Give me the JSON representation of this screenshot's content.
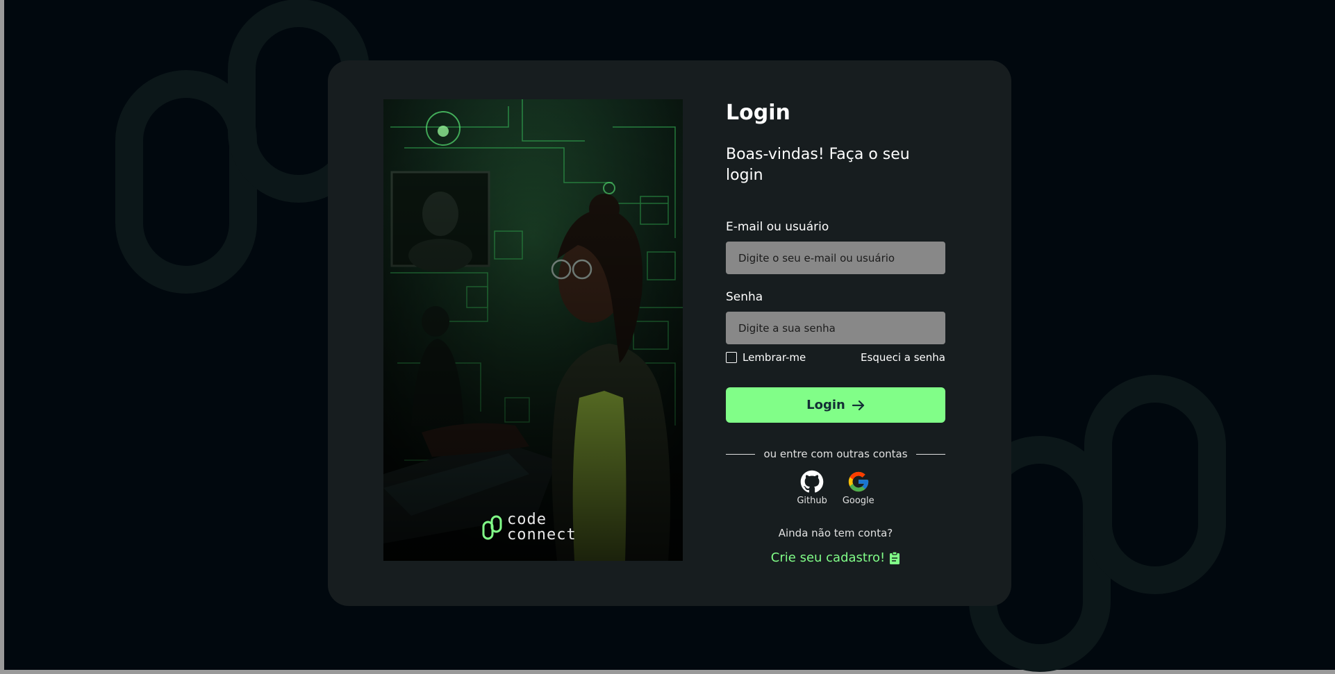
{
  "colors": {
    "background": "#01080e",
    "card": "#171d1f",
    "accent": "#81fe88",
    "input_bg": "#888888",
    "text": "#e1e1e1"
  },
  "banner": {
    "logo_line1": "code",
    "logo_line2": "connect",
    "logo_icon": "chain-link-icon"
  },
  "form": {
    "title": "Login",
    "subtitle": "Boas-vindas! Faça o seu login",
    "email_label": "E-mail ou usuário",
    "email_placeholder": "Digite o seu e-mail ou usuário",
    "email_value": "",
    "password_label": "Senha",
    "password_placeholder": "Digite a sua senha",
    "password_value": "",
    "remember_label": "Lembrar-me",
    "remember_checked": false,
    "forgot_label": "Esqueci a senha",
    "login_button": "Login",
    "login_button_icon": "arrow-right-icon",
    "divider_text": "ou entre com outras contas",
    "socials": [
      {
        "label": "Github",
        "icon": "github-icon"
      },
      {
        "label": "Google",
        "icon": "google-icon"
      }
    ],
    "no_account_text": "Ainda não tem conta?",
    "signup_label": "Crie seu cadastro!",
    "signup_icon": "clipboard-icon"
  }
}
